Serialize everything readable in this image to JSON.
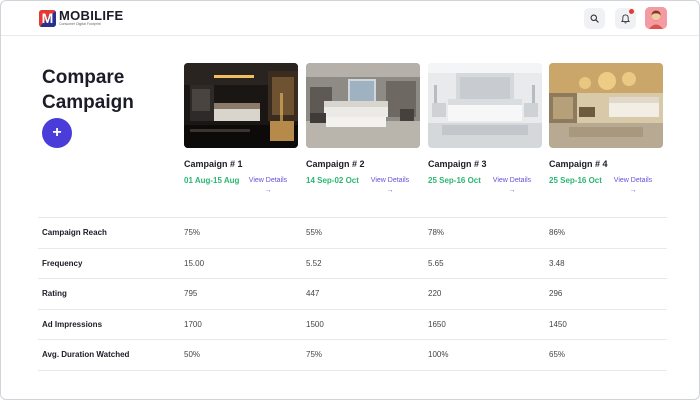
{
  "header": {
    "brand_name": "MOBILIFE",
    "brand_tagline": "Consumer Digital Footprint",
    "logo_letter": "M",
    "search_icon": "search-icon",
    "bell_icon": "bell-icon",
    "has_notification": true
  },
  "page": {
    "title": "Compare Campaign",
    "add_label": "+"
  },
  "campaigns": [
    {
      "name": "Campaign # 1",
      "dates": "01 Aug-15 Aug",
      "view": "View Details",
      "arrow": "→"
    },
    {
      "name": "Campaign # 2",
      "dates": "14 Sep-02 Oct",
      "view": "View Details",
      "arrow": "→"
    },
    {
      "name": "Campaign # 3",
      "dates": "25 Sep-16 Oct",
      "view": "View Details",
      "arrow": "→"
    },
    {
      "name": "Campaign # 4",
      "dates": "25 Sep-16 Oct",
      "view": "View Details",
      "arrow": "→"
    }
  ],
  "metrics": [
    {
      "label": "Campaign Reach",
      "values": [
        "75%",
        "55%",
        "78%",
        "86%"
      ]
    },
    {
      "label": "Frequency",
      "values": [
        "15.00",
        "5.52",
        "5.65",
        "3.48"
      ]
    },
    {
      "label": "Rating",
      "values": [
        "795",
        "447",
        "220",
        "296"
      ]
    },
    {
      "label": "Ad Impressions",
      "values": [
        "1700",
        "1500",
        "1650",
        "1450"
      ]
    },
    {
      "label": "Avg. Duration Watched",
      "values": [
        "50%",
        "75%",
        "100%",
        "65%"
      ]
    }
  ],
  "colors": {
    "accent": "#4a3cd8",
    "date_green": "#2bb673",
    "link_purple": "#6b4fd8",
    "notification": "#e53935"
  }
}
